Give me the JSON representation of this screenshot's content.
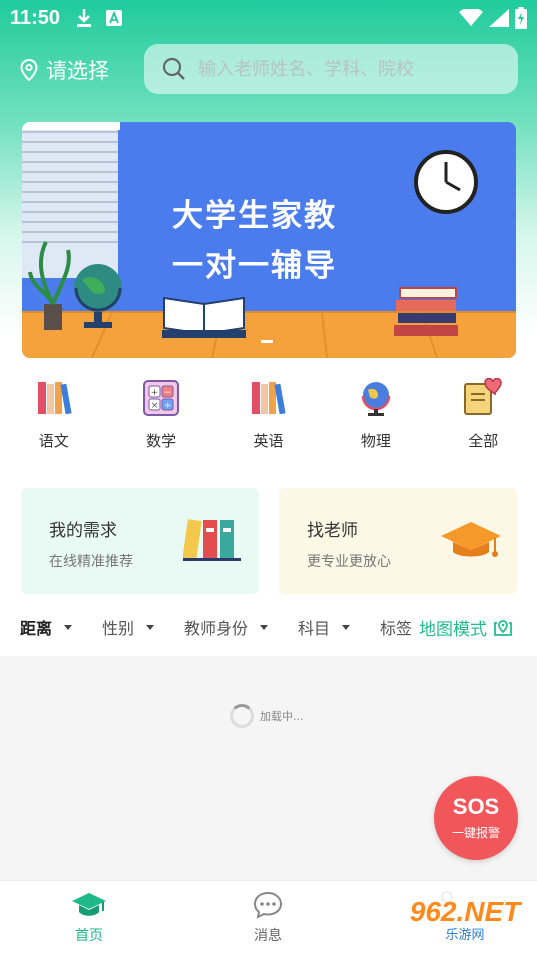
{
  "status_bar": {
    "time": "11:50"
  },
  "header": {
    "location_label": "请选择",
    "search_placeholder": "输入老师姓名、学科、院校"
  },
  "banner": {
    "line1": "大学生家教",
    "line2": "一对一辅导"
  },
  "categories": [
    {
      "label": "语文",
      "icon": "books-icon"
    },
    {
      "label": "数学",
      "icon": "calculator-icon"
    },
    {
      "label": "英语",
      "icon": "books-icon"
    },
    {
      "label": "物理",
      "icon": "globe-icon"
    },
    {
      "label": "全部",
      "icon": "book-heart-icon"
    }
  ],
  "cards": {
    "demand": {
      "title": "我的需求",
      "subtitle": "在线精准推荐"
    },
    "teacher": {
      "title": "找老师",
      "subtitle": "更专业更放心"
    }
  },
  "filters": {
    "distance": "距离",
    "gender": "性别",
    "identity": "教师身份",
    "subject": "科目",
    "tag": "标签",
    "map_mode": "地图模式"
  },
  "list": {
    "loading_text": "加载中..."
  },
  "sos": {
    "big": "SOS",
    "small": "一键报警"
  },
  "tabbar": {
    "home": "首页",
    "messages": "消息"
  },
  "watermark": {
    "top": "962.NET",
    "bottom": "乐游网"
  },
  "colors": {
    "accent": "#1fcb9c",
    "sos": "#f1575a",
    "banner": "#4b7cee"
  }
}
